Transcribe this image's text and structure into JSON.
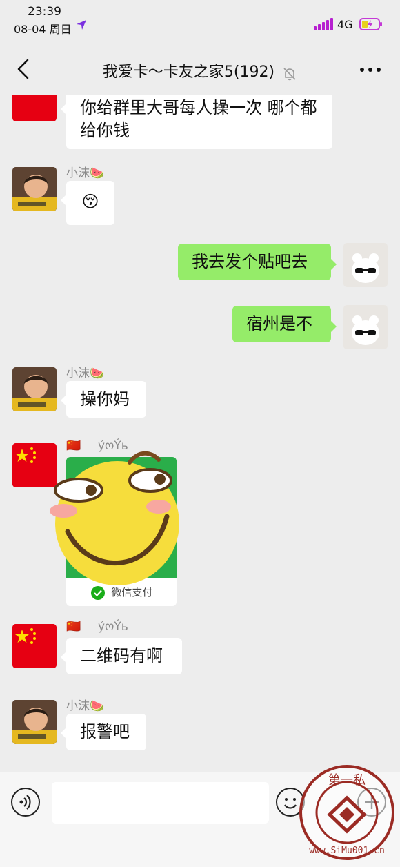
{
  "status_bar": {
    "time": "23:39",
    "date": "08-04 周日",
    "network": "4G"
  },
  "header": {
    "title": "我爱卡～卡友之家5(192)"
  },
  "messages": [
    {
      "text": "你给群里大哥每人操一次 哪个都给你钱"
    },
    {
      "sender": "小沫🍉",
      "text": "😚"
    },
    {
      "text": "我去发个贴吧去"
    },
    {
      "text": "宿州是不"
    },
    {
      "sender": "小沫🍉",
      "text": "操你妈"
    },
    {
      "sender": "🇨🇳",
      "sender_name": "ỷოÝь",
      "card_label": "微信支付"
    },
    {
      "sender": "🇨🇳",
      "sender_name": "ỷოÝь",
      "text": "二维码有啊"
    },
    {
      "sender": "小沫🍉",
      "text": "报警吧"
    }
  ],
  "input": {
    "placeholder": ""
  },
  "watermark": {
    "top_text": "第一私",
    "bottom_text": "www.SiMu001.cn"
  },
  "colors": {
    "background": "#ededed",
    "my_bubble": "#95ec69",
    "their_bubble": "#ffffff",
    "flag_red": "#e60012",
    "qr_green": "#2aae4a",
    "signal_purple": "#b61fd0"
  },
  "icons": [
    "back-arrow-icon",
    "mute-bell-icon",
    "more-dots-icon",
    "location-arrow-icon",
    "battery-charging-icon",
    "signal-icon",
    "voice-icon",
    "emoji-icon",
    "plus-icon",
    "wechat-pay-icon"
  ]
}
